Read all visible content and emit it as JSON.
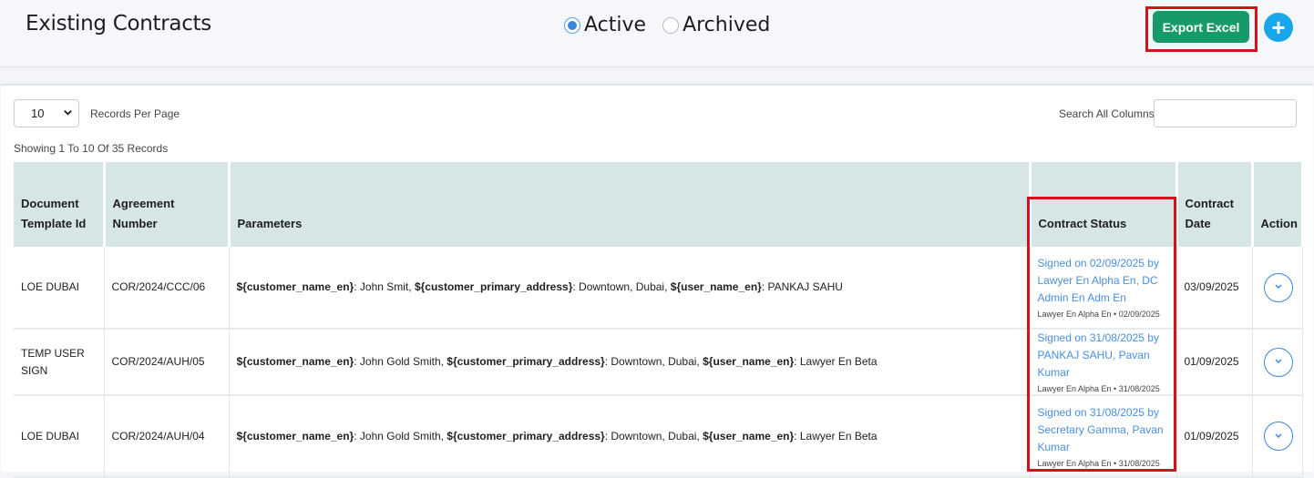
{
  "header": {
    "title": "Existing Contracts",
    "filters": [
      {
        "label": "Active",
        "checked": true
      },
      {
        "label": "Archived",
        "checked": false
      }
    ],
    "export_label": "Export Excel",
    "add_symbol": "+"
  },
  "toolbar": {
    "records_per_page_value": "10",
    "records_per_page_label": "Records Per Page",
    "search_label": "Search All Columns",
    "search_value": "",
    "showing_text": "Showing 1 To 10 Of 35 Records"
  },
  "table": {
    "columns": [
      "Document Template Id",
      "Agreement Number",
      "Parameters",
      "Contract Status",
      "Contract Date",
      "Action"
    ],
    "rows": [
      {
        "template_id": "LOE DUBAI",
        "agreement_number": "COR/2024/CCC/06",
        "params": [
          {
            "key": "${customer_name_en}",
            "value": ": John Smit, "
          },
          {
            "key": "${customer_primary_address}",
            "value": ": Downtown, Dubai, "
          },
          {
            "key": "${user_name_en}",
            "value": ": PANKAJ SAHU"
          }
        ],
        "status_line1": "Signed on 02/09/2025 by",
        "status_line2": "Lawyer En Alpha En, DC",
        "status_line3": "Admin En Adm En",
        "status_meta": "Lawyer En Alpha En • 02/09/2025",
        "contract_date": "03/09/2025"
      },
      {
        "template_id_line1": "TEMP USER",
        "template_id_line2": "SIGN",
        "agreement_number": "COR/2024/AUH/05",
        "params": [
          {
            "key": "${customer_name_en}",
            "value": ": John Gold Smith, "
          },
          {
            "key": "${customer_primary_address}",
            "value": ": Downtown, Dubai, "
          },
          {
            "key": "${user_name_en}",
            "value": ": Lawyer En Beta"
          }
        ],
        "status_line1": "Signed on 31/08/2025 by",
        "status_line2": "PANKAJ SAHU, Pavan Kumar",
        "status_meta": "Lawyer En Alpha En • 31/08/2025",
        "contract_date": "01/09/2025"
      },
      {
        "template_id": "LOE DUBAI",
        "agreement_number": "COR/2024/AUH/04",
        "params": [
          {
            "key": "${customer_name_en}",
            "value": ": John Gold Smith, "
          },
          {
            "key": "${customer_primary_address}",
            "value": ": Downtown, Dubai, "
          },
          {
            "key": "${user_name_en}",
            "value": ": Lawyer En Beta"
          }
        ],
        "status_line1": "Signed on 31/08/2025 by",
        "status_line2": "Secretary Gamma, Pavan",
        "status_line3": "Kumar",
        "status_meta": "Lawyer En Alpha En • 31/08/2025",
        "contract_date": "01/09/2025"
      }
    ]
  },
  "colors": {
    "export_button": "#169a6a",
    "add_button": "#18a7e8",
    "header_row": "#d6e5e6",
    "link": "#4a8fdc",
    "highlight_frame": "#d6111b"
  },
  "icons": {
    "add": "plus-circle-icon",
    "action": "chevron-down-circle-icon",
    "select_chevron": "chevron-down-icon"
  }
}
